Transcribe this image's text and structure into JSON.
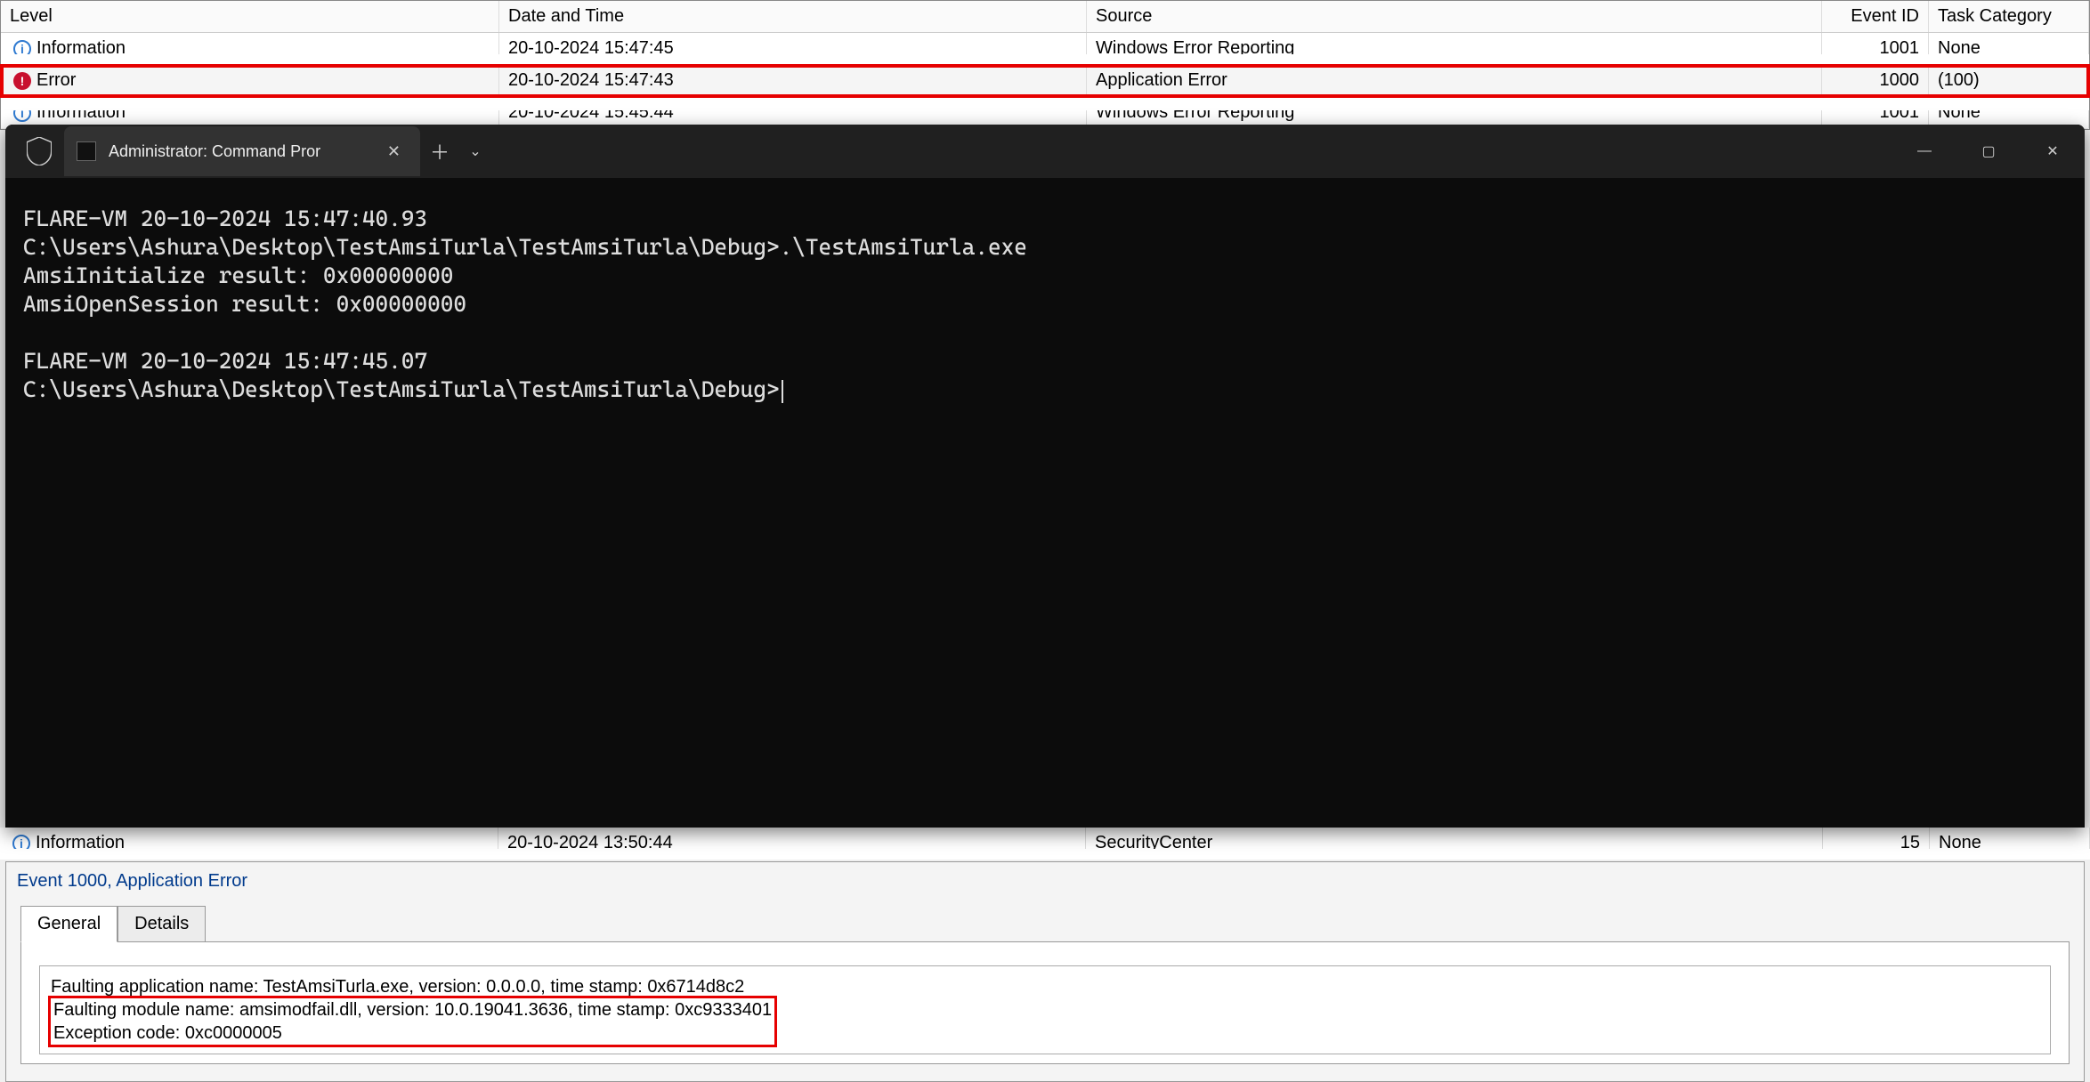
{
  "event_viewer": {
    "columns": {
      "level": "Level",
      "date": "Date and Time",
      "source": "Source",
      "eid": "Event ID",
      "task": "Task Category"
    },
    "rows": [
      {
        "icon": "info",
        "level": "Information",
        "date": "20-10-2024 15:47:45",
        "source": "Windows Error Reporting",
        "eid": "1001",
        "task": "None"
      },
      {
        "icon": "error",
        "level": "Error",
        "date": "20-10-2024 15:47:43",
        "source": "Application Error",
        "eid": "1000",
        "task": "(100)"
      },
      {
        "icon": "info",
        "level": "Information",
        "date": "20-10-2024 15:45:44",
        "source": "Windows Error Reporting",
        "eid": "1001",
        "task": "None"
      }
    ],
    "peek_row": {
      "icon": "info",
      "level": "Information",
      "date": "20-10-2024 13:50:44",
      "source": "SecurityCenter",
      "eid": "15",
      "task": "None"
    }
  },
  "terminal": {
    "tab_title": "Administrator: Command Pror",
    "lines": [
      "FLARE-VM 20-10-2024 15:47:40.93",
      "C:\\Users\\Ashura\\Desktop\\TestAmsiTurla\\TestAmsiTurla\\Debug>.\\TestAmsiTurla.exe",
      "AmsiInitialize result: 0x00000000",
      "AmsiOpenSession result: 0x00000000",
      "",
      "FLARE-VM 20-10-2024 15:47:45.07",
      "C:\\Users\\Ashura\\Desktop\\TestAmsiTurla\\TestAmsiTurla\\Debug>"
    ]
  },
  "details": {
    "title": "Event 1000, Application Error",
    "tabs": {
      "general": "General",
      "details": "Details"
    },
    "body_lines": [
      "Faulting application name: TestAmsiTurla.exe, version: 0.0.0.0, time stamp: 0x6714d8c2",
      "Faulting module name: amsimodfail.dll, version: 10.0.19041.3636, time stamp: 0xc9333401",
      "Exception code: 0xc0000005"
    ]
  }
}
